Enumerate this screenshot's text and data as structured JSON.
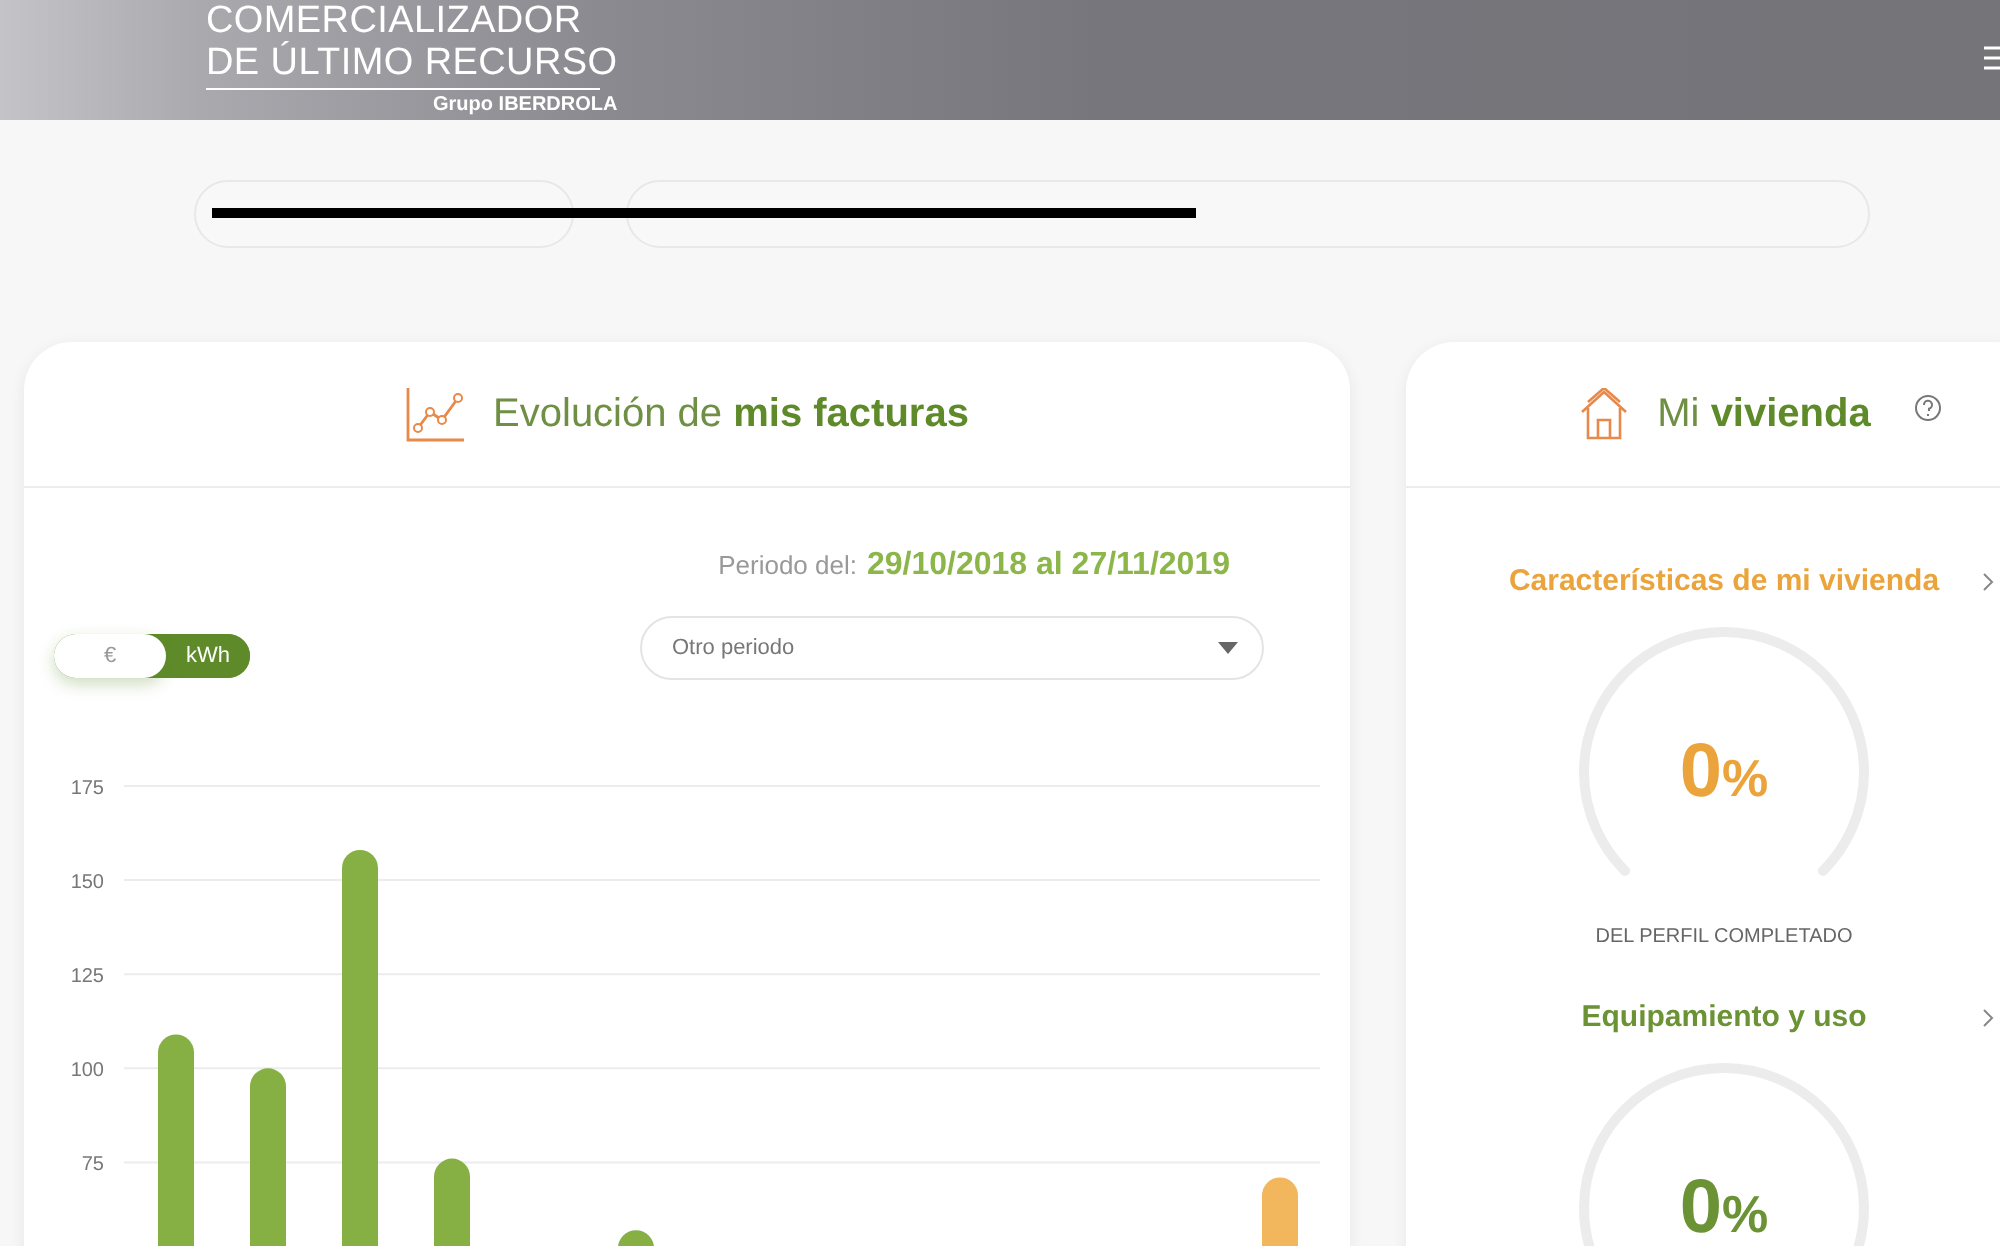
{
  "header": {
    "logo_lines": [
      "COMERCIALIZADOR",
      "DE ÚLTIMO RECURSO"
    ],
    "logo_group": "Grupo IBERDROLA"
  },
  "filters": {
    "redacted": true
  },
  "invoices_card": {
    "title": "Evolución de **mis facturas**",
    "period_label": "Periodo del:",
    "period_value": "29/10/2018 al 27/11/2019",
    "units": [
      {
        "label": "€",
        "selected": false
      },
      {
        "label": "kWh",
        "selected": true
      }
    ],
    "period_select": {
      "value": "Otro periodo"
    },
    "chart_data": {
      "type": "bar",
      "grid": true,
      "ylim": [
        48,
        175
      ],
      "yticks": [
        75,
        100,
        125,
        150,
        175
      ],
      "series": [
        {
          "color": "#86b043",
          "values": [
            109,
            100,
            158,
            76,
            null,
            57,
            null,
            null,
            null,
            null,
            null,
            null,
            null
          ]
        },
        {
          "color": "#f2b65c",
          "values": [
            null,
            null,
            null,
            null,
            null,
            null,
            null,
            null,
            null,
            null,
            null,
            null,
            71
          ]
        }
      ]
    }
  },
  "home_card": {
    "title": "Mi **vivienda**",
    "sections": [
      {
        "title": "Características de mi vivienda",
        "color": "#eba43c",
        "value": "0",
        "unit": "%",
        "caption": "DEL PERFIL COMPLETADO"
      },
      {
        "title": "Equipamiento y uso",
        "color": "#6b9234",
        "value": "0",
        "unit": "%"
      }
    ]
  }
}
